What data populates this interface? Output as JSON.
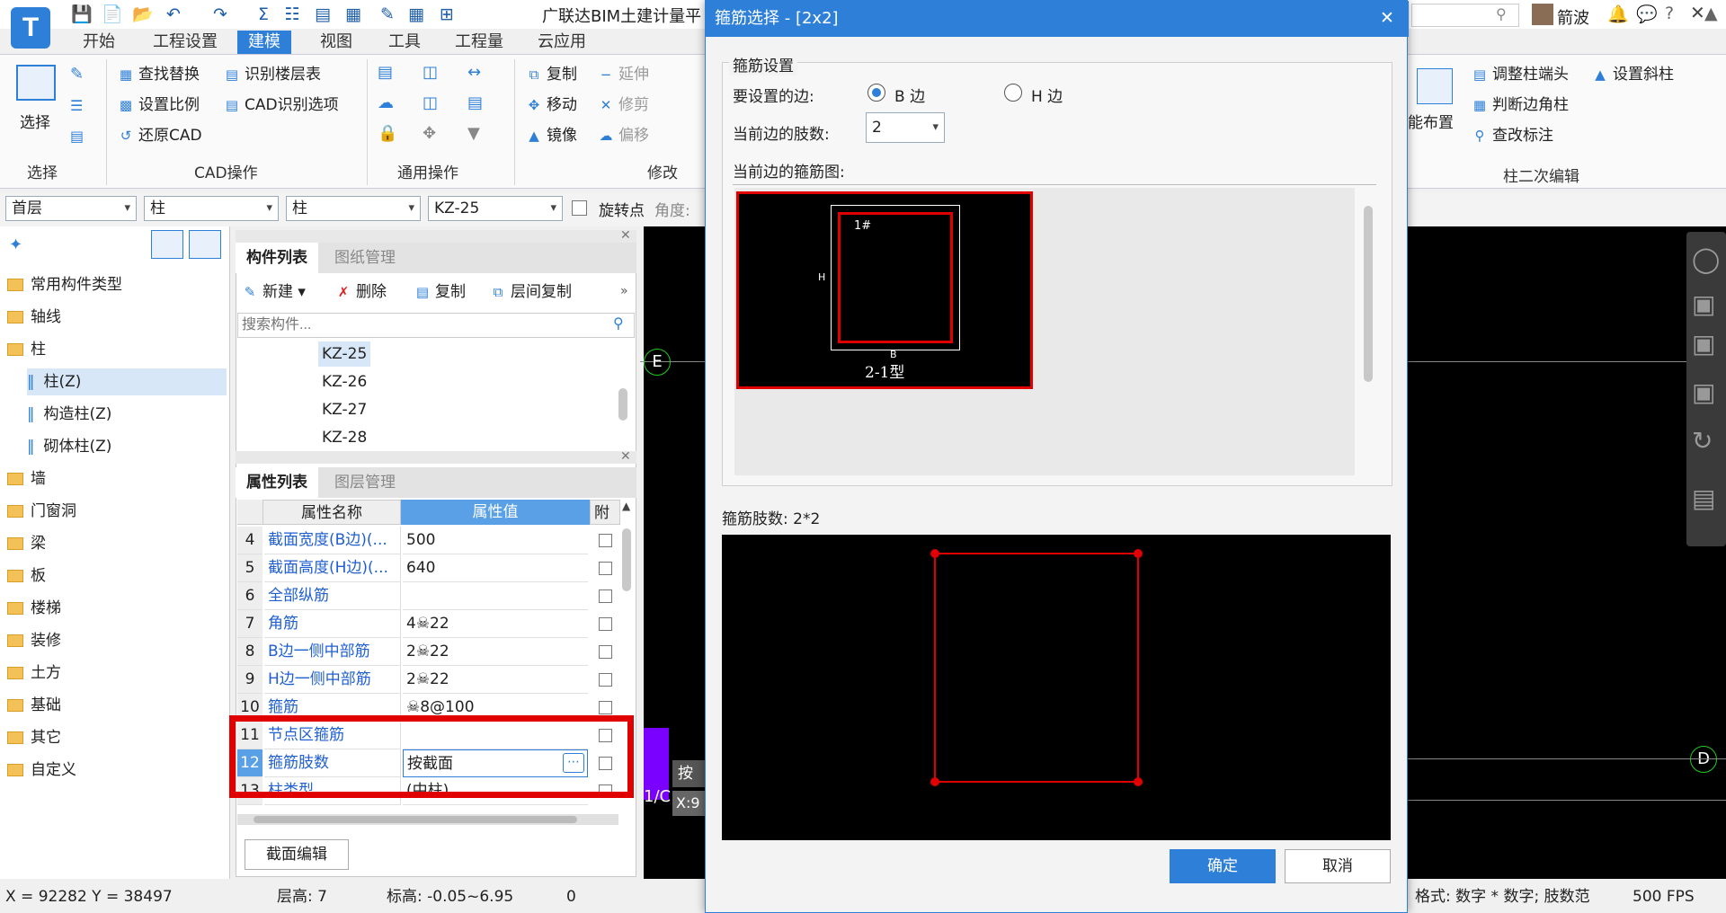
{
  "app": {
    "title": "广联达BIM土建计量平",
    "logo_text": "T",
    "user": "箭波",
    "tabs": [
      "开始",
      "工程设置",
      "建模",
      "视图",
      "工具",
      "工程量",
      "云应用"
    ],
    "active_tab": "建模"
  },
  "ribbon": {
    "select_label": "选择",
    "cad_items": [
      "查找替换",
      "识别楼层表",
      "设置比例",
      "CAD识别选项",
      "还原CAD"
    ],
    "modify_items": [
      "复制",
      "延伸",
      "移动",
      "修剪",
      "镜像",
      "偏移"
    ],
    "right_items": [
      "调整柱端头",
      "设置斜柱",
      "判断边角柱",
      "查改标注"
    ],
    "smart_layout": "能布置",
    "groups": {
      "select": "选择",
      "cad": "CAD操作",
      "general": "通用操作",
      "modify": "修改",
      "column2": "柱二次编辑"
    }
  },
  "combos": {
    "floor": "首层",
    "type1": "柱",
    "type2": "柱",
    "component": "KZ-25",
    "rotate_label": "旋转点",
    "angle_label": "角度:"
  },
  "left_tree": [
    {
      "label": "常用构件类型",
      "level": 0
    },
    {
      "label": "轴线",
      "level": 0
    },
    {
      "label": "柱",
      "level": 0,
      "open": true
    },
    {
      "label": "柱(Z)",
      "level": 1,
      "selected": true
    },
    {
      "label": "构造柱(Z)",
      "level": 1
    },
    {
      "label": "砌体柱(Z)",
      "level": 1
    },
    {
      "label": "墙",
      "level": 0
    },
    {
      "label": "门窗洞",
      "level": 0
    },
    {
      "label": "梁",
      "level": 0
    },
    {
      "label": "板",
      "level": 0
    },
    {
      "label": "楼梯",
      "level": 0
    },
    {
      "label": "装修",
      "level": 0
    },
    {
      "label": "土方",
      "level": 0
    },
    {
      "label": "基础",
      "level": 0
    },
    {
      "label": "其它",
      "level": 0
    },
    {
      "label": "自定义",
      "level": 0
    }
  ],
  "component_panel": {
    "tabs": [
      "构件列表",
      "图纸管理"
    ],
    "tools": [
      "新建",
      "删除",
      "复制",
      "层间复制"
    ],
    "search_placeholder": "搜索构件...",
    "items": [
      "KZ-25",
      "KZ-26",
      "KZ-27",
      "KZ-28"
    ]
  },
  "property_panel": {
    "tabs": [
      "属性列表",
      "图层管理"
    ],
    "headers": [
      "属性名称",
      "属性值",
      "附"
    ],
    "rows": [
      {
        "n": "4",
        "name": "截面宽度(B边)(...",
        "value": "500"
      },
      {
        "n": "5",
        "name": "截面高度(H边)(...",
        "value": "640"
      },
      {
        "n": "6",
        "name": "全部纵筋",
        "value": ""
      },
      {
        "n": "7",
        "name": "角筋",
        "value": "4☠22"
      },
      {
        "n": "8",
        "name": "B边一侧中部筋",
        "value": "2☠22"
      },
      {
        "n": "9",
        "name": "H边一侧中部筋",
        "value": "2☠22"
      },
      {
        "n": "10",
        "name": "箍筋",
        "value": "☠8@100"
      },
      {
        "n": "11",
        "name": "节点区箍筋",
        "value": ""
      },
      {
        "n": "12",
        "name": "箍筋肢数",
        "value": "按截面"
      },
      {
        "n": "13",
        "name": "柱类型",
        "value": "(中柱)"
      }
    ],
    "section_edit": "截面编辑"
  },
  "canvas": {
    "axis_labels": [
      "E",
      "E",
      "D"
    ],
    "popup_text": "按",
    "coord_text": "X:9",
    "side_text": "1/C"
  },
  "status": {
    "coords": "X = 92282 Y = 38497",
    "floor_height": "层高:  7",
    "elevation": "标高: -0.05~6.95",
    "zero": "0",
    "right_text": "格式: 数字 * 数字; 肢数范",
    "fps": "500 FPS"
  },
  "dialog": {
    "title": "箍筋选择 - [2x2]",
    "close": "✕",
    "group_title": "箍筋设置",
    "side_label": "要设置的边:",
    "option_b": "B 边",
    "option_h": "H 边",
    "selected_option": "B 边",
    "legs_label": "当前边的肢数:",
    "legs_value": "2",
    "diagram_label": "当前边的箍筋图:",
    "thumb_caption": "2-1型",
    "thumb_b": "B",
    "thumb_h": "H",
    "thumb_mark": "1#",
    "count_label": "箍筋肢数: 2*2",
    "ok": "确定",
    "cancel": "取消"
  }
}
